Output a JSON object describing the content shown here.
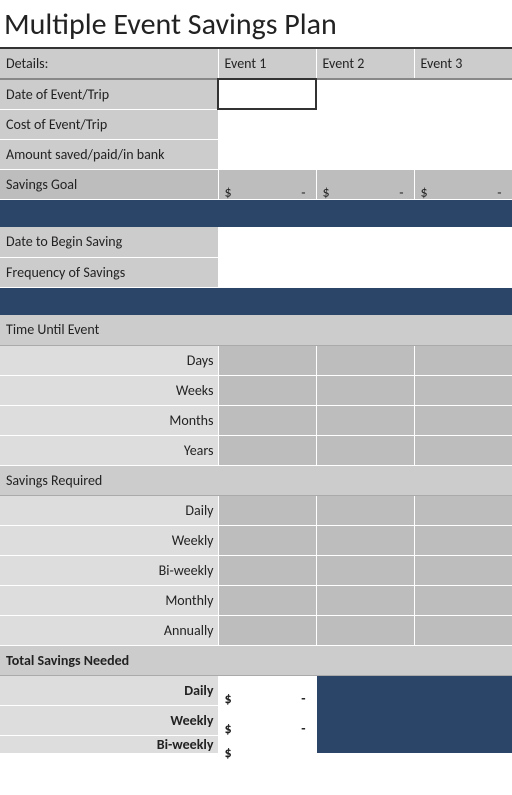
{
  "title": "Multiple Event Savings Plan",
  "headers": {
    "details": "Details:",
    "events": [
      "Event 1",
      "Event 2",
      "Event 3"
    ]
  },
  "rows": {
    "date_of_event": "Date of Event/Trip",
    "cost_of_event": "Cost of Event/Trip",
    "amount_saved": "Amount saved/paid/in bank",
    "savings_goal": "Savings Goal",
    "date_begin": "Date to Begin Saving",
    "frequency": "Frequency of Savings"
  },
  "goal_values": [
    {
      "symbol": "$",
      "value": "-"
    },
    {
      "symbol": "$",
      "value": "-"
    },
    {
      "symbol": "$",
      "value": "-"
    }
  ],
  "sections": {
    "time_until": {
      "label": "Time Until Event",
      "items": [
        "Days",
        "Weeks",
        "Months",
        "Years"
      ]
    },
    "savings_required": {
      "label": "Savings Required",
      "items": [
        "Daily",
        "Weekly",
        "Bi-weekly",
        "Monthly",
        "Annually"
      ]
    },
    "total_savings": {
      "label": "Total Savings Needed",
      "items": [
        {
          "label": "Daily",
          "symbol": "$",
          "value": "-"
        },
        {
          "label": "Weekly",
          "symbol": "$",
          "value": "-"
        },
        {
          "label": "Bi-weekly",
          "symbol": "$",
          "value": ""
        }
      ]
    }
  }
}
